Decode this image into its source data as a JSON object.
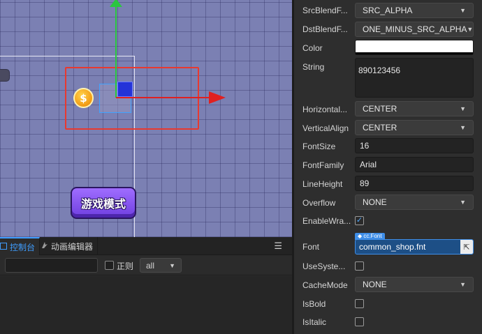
{
  "scene": {
    "coin_glyph": "$",
    "game_mode_label": "游戏模式",
    "colors": {
      "grid_bg": "#7b80b3",
      "selection": "#e8392f",
      "axis_x": "#e02020",
      "axis_y": "#2ac640",
      "handle": "#2433d8"
    }
  },
  "console": {
    "tab_console": "控制台",
    "tab_animation": "动画编辑器",
    "menu_icon": "☰",
    "filter_value": "",
    "regex_label": "正则",
    "level_value": "all"
  },
  "inspector": {
    "src_blend": {
      "label": "SrcBlendF...",
      "value": "SRC_ALPHA"
    },
    "dst_blend": {
      "label": "DstBlendF...",
      "value": "ONE_MINUS_SRC_ALPHA"
    },
    "color": {
      "label": "Color",
      "value": "#ffffff"
    },
    "string": {
      "label": "String",
      "value": "890123456"
    },
    "horizontal_align": {
      "label": "Horizontal...",
      "value": "CENTER"
    },
    "vertical_align": {
      "label": "VerticalAlign",
      "value": "CENTER"
    },
    "font_size": {
      "label": "FontSize",
      "value": "16"
    },
    "font_family": {
      "label": "FontFamily",
      "value": "Arial"
    },
    "line_height": {
      "label": "LineHeight",
      "value": "89"
    },
    "overflow": {
      "label": "Overflow",
      "value": "NONE"
    },
    "enable_wrap": {
      "label": "EnableWra...",
      "checked": true
    },
    "font": {
      "label": "Font",
      "type_tag": "cc.Font",
      "value": "common_shop.fnt"
    },
    "use_system": {
      "label": "UseSyste...",
      "checked": false
    },
    "cache_mode": {
      "label": "CacheMode",
      "value": "NONE"
    },
    "is_bold": {
      "label": "IsBold",
      "checked": false
    },
    "is_italic": {
      "label": "IsItalic",
      "checked": false
    }
  }
}
